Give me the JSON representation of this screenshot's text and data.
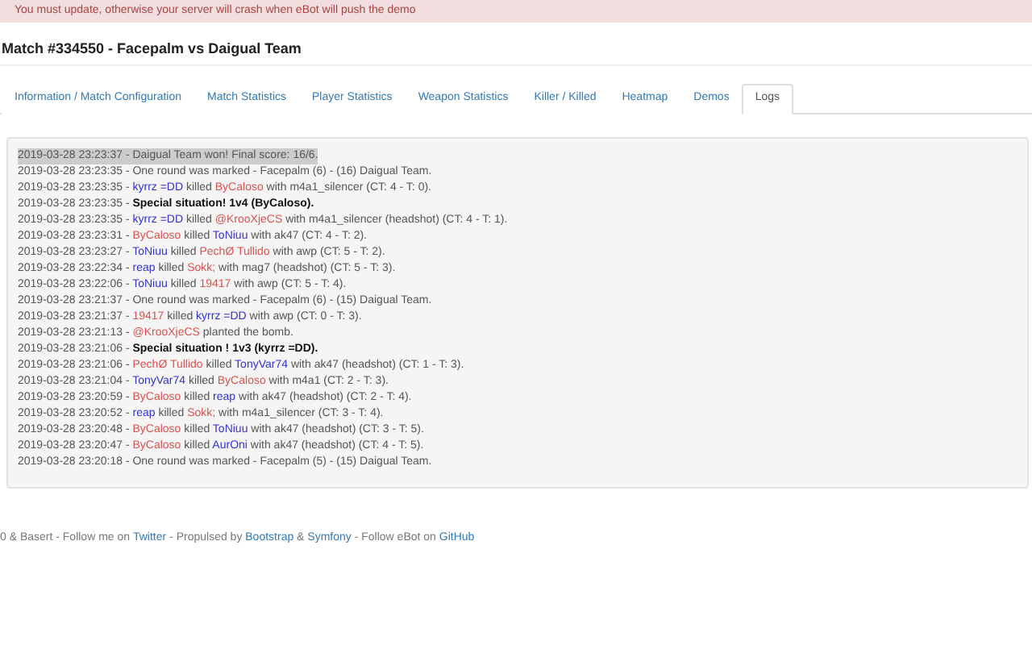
{
  "alert": "You must update, otherwise your server will crash when eBot will push the demo",
  "title": "Match #334550 - Facepalm vs Daigual Team",
  "tabs": [
    {
      "label": "Information / Match Configuration",
      "selected": false
    },
    {
      "label": "Match Statistics",
      "selected": false
    },
    {
      "label": "Player Statistics",
      "selected": false
    },
    {
      "label": "Weapon Statistics",
      "selected": false
    },
    {
      "label": "Killer / Killed",
      "selected": false
    },
    {
      "label": "Heatmap",
      "selected": false
    },
    {
      "label": "Demos",
      "selected": false
    },
    {
      "label": "Logs",
      "selected": true
    }
  ],
  "logs": [
    {
      "highlighted": true,
      "parts": [
        {
          "kind": "plain",
          "text": "2019-03-28 23:23:37 - Daigual Team won! Final score: 16/6."
        }
      ]
    },
    {
      "highlighted": false,
      "parts": [
        {
          "kind": "plain",
          "text": "2019-03-28 23:23:35 - One round was marked - Facepalm (6) - (16) Daigual Team."
        }
      ]
    },
    {
      "highlighted": false,
      "parts": [
        {
          "kind": "plain",
          "text": "2019-03-28 23:23:35 - "
        },
        {
          "kind": "ct",
          "text": "kyrrz =DD"
        },
        {
          "kind": "plain",
          "text": " killed "
        },
        {
          "kind": "t",
          "text": "ByCaloso"
        },
        {
          "kind": "plain",
          "text": " with m4a1_silencer (CT: 4 - T: 0)."
        }
      ]
    },
    {
      "highlighted": false,
      "parts": [
        {
          "kind": "plain",
          "text": "2019-03-28 23:23:35 - "
        },
        {
          "kind": "bold",
          "text": "Special situation! 1v4 (ByCaloso)."
        }
      ]
    },
    {
      "highlighted": false,
      "parts": [
        {
          "kind": "plain",
          "text": "2019-03-28 23:23:35 - "
        },
        {
          "kind": "ct",
          "text": "kyrrz =DD"
        },
        {
          "kind": "plain",
          "text": " killed "
        },
        {
          "kind": "t",
          "text": "@KrooXjeCS"
        },
        {
          "kind": "plain",
          "text": " with m4a1_silencer (headshot) (CT: 4 - T: 1)."
        }
      ]
    },
    {
      "highlighted": false,
      "parts": [
        {
          "kind": "plain",
          "text": "2019-03-28 23:23:31 - "
        },
        {
          "kind": "t",
          "text": "ByCaloso"
        },
        {
          "kind": "plain",
          "text": " killed "
        },
        {
          "kind": "ct",
          "text": "ToNiuu"
        },
        {
          "kind": "plain",
          "text": " with ak47 (CT: 4 - T: 2)."
        }
      ]
    },
    {
      "highlighted": false,
      "parts": [
        {
          "kind": "plain",
          "text": "2019-03-28 23:23:27 - "
        },
        {
          "kind": "ct",
          "text": "ToNiuu"
        },
        {
          "kind": "plain",
          "text": " killed "
        },
        {
          "kind": "t",
          "text": "PechØ Tullido"
        },
        {
          "kind": "plain",
          "text": " with awp (CT: 5 - T: 2)."
        }
      ]
    },
    {
      "highlighted": false,
      "parts": [
        {
          "kind": "plain",
          "text": "2019-03-28 23:22:34 - "
        },
        {
          "kind": "ct",
          "text": "reap"
        },
        {
          "kind": "plain",
          "text": " killed "
        },
        {
          "kind": "t",
          "text": "Sokk;"
        },
        {
          "kind": "plain",
          "text": " with mag7 (headshot) (CT: 5 - T: 3)."
        }
      ]
    },
    {
      "highlighted": false,
      "parts": [
        {
          "kind": "plain",
          "text": "2019-03-28 23:22:06 - "
        },
        {
          "kind": "ct",
          "text": "ToNiuu"
        },
        {
          "kind": "plain",
          "text": " killed "
        },
        {
          "kind": "t",
          "text": "19417"
        },
        {
          "kind": "plain",
          "text": " with awp (CT: 5 - T: 4)."
        }
      ]
    },
    {
      "highlighted": false,
      "parts": [
        {
          "kind": "plain",
          "text": "2019-03-28 23:21:37 - One round was marked - Facepalm (6) - (15) Daigual Team."
        }
      ]
    },
    {
      "highlighted": false,
      "parts": [
        {
          "kind": "plain",
          "text": "2019-03-28 23:21:37 - "
        },
        {
          "kind": "t",
          "text": "19417"
        },
        {
          "kind": "plain",
          "text": " killed "
        },
        {
          "kind": "ct",
          "text": "kyrrz =DD"
        },
        {
          "kind": "plain",
          "text": " with awp (CT: 0 - T: 3)."
        }
      ]
    },
    {
      "highlighted": false,
      "parts": [
        {
          "kind": "plain",
          "text": "2019-03-28 23:21:13 - "
        },
        {
          "kind": "t",
          "text": "@KrooXjeCS"
        },
        {
          "kind": "plain",
          "text": " planted the bomb."
        }
      ]
    },
    {
      "highlighted": false,
      "parts": [
        {
          "kind": "plain",
          "text": "2019-03-28 23:21:06 - "
        },
        {
          "kind": "bold",
          "text": "Special situation ! 1v3 (kyrrz =DD)."
        }
      ]
    },
    {
      "highlighted": false,
      "parts": [
        {
          "kind": "plain",
          "text": "2019-03-28 23:21:06 - "
        },
        {
          "kind": "t",
          "text": "PechØ Tullido"
        },
        {
          "kind": "plain",
          "text": " killed "
        },
        {
          "kind": "ct",
          "text": "TonyVar74"
        },
        {
          "kind": "plain",
          "text": " with ak47 (headshot) (CT: 1 - T: 3)."
        }
      ]
    },
    {
      "highlighted": false,
      "parts": [
        {
          "kind": "plain",
          "text": "2019-03-28 23:21:04 - "
        },
        {
          "kind": "ct",
          "text": "TonyVar74"
        },
        {
          "kind": "plain",
          "text": " killed "
        },
        {
          "kind": "t",
          "text": "ByCaloso"
        },
        {
          "kind": "plain",
          "text": " with m4a1 (CT: 2 - T: 3)."
        }
      ]
    },
    {
      "highlighted": false,
      "parts": [
        {
          "kind": "plain",
          "text": "2019-03-28 23:20:59 - "
        },
        {
          "kind": "t",
          "text": "ByCaloso"
        },
        {
          "kind": "plain",
          "text": " killed "
        },
        {
          "kind": "ct",
          "text": "reap"
        },
        {
          "kind": "plain",
          "text": " with ak47 (headshot) (CT: 2 - T: 4)."
        }
      ]
    },
    {
      "highlighted": false,
      "parts": [
        {
          "kind": "plain",
          "text": "2019-03-28 23:20:52 - "
        },
        {
          "kind": "ct",
          "text": "reap"
        },
        {
          "kind": "plain",
          "text": " killed "
        },
        {
          "kind": "t",
          "text": "Sokk;"
        },
        {
          "kind": "plain",
          "text": " with m4a1_silencer (CT: 3 - T: 4)."
        }
      ]
    },
    {
      "highlighted": false,
      "parts": [
        {
          "kind": "plain",
          "text": "2019-03-28 23:20:48 - "
        },
        {
          "kind": "t",
          "text": "ByCaloso"
        },
        {
          "kind": "plain",
          "text": " killed "
        },
        {
          "kind": "ct",
          "text": "ToNiuu"
        },
        {
          "kind": "plain",
          "text": " with ak47 (headshot) (CT: 3 - T: 5)."
        }
      ]
    },
    {
      "highlighted": false,
      "parts": [
        {
          "kind": "plain",
          "text": "2019-03-28 23:20:47 - "
        },
        {
          "kind": "t",
          "text": "ByCaloso"
        },
        {
          "kind": "plain",
          "text": " killed "
        },
        {
          "kind": "ct",
          "text": "AurOni"
        },
        {
          "kind": "plain",
          "text": " with ak47 (headshot) (CT: 4 - T: 5)."
        }
      ]
    },
    {
      "highlighted": false,
      "parts": [
        {
          "kind": "plain",
          "text": "2019-03-28 23:20:18 - One round was marked - Facepalm (5) - (15) Daigual Team."
        }
      ]
    }
  ],
  "footer": [
    {
      "kind": "text",
      "text": "0 & Basert - Follow me on "
    },
    {
      "kind": "link",
      "text": "Twitter"
    },
    {
      "kind": "text",
      "text": " - Propulsed by "
    },
    {
      "kind": "link",
      "text": "Bootstrap"
    },
    {
      "kind": "text",
      "text": " & "
    },
    {
      "kind": "link",
      "text": "Symfony"
    },
    {
      "kind": "text",
      "text": " - Follow eBot on "
    },
    {
      "kind": "link",
      "text": "GitHub"
    }
  ]
}
